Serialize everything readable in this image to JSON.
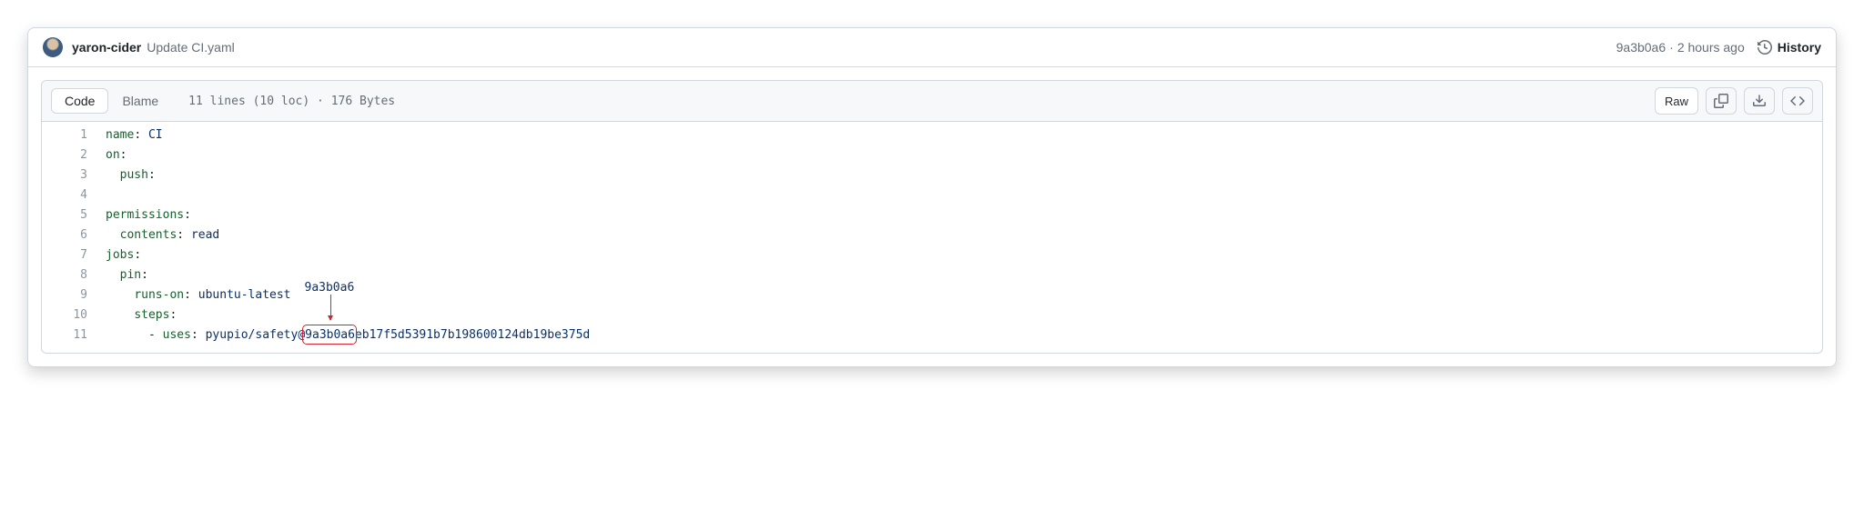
{
  "commit_bar": {
    "author": "yaron-cider",
    "message": "Update CI.yaml",
    "sha": "9a3b0a6",
    "sep": " · ",
    "time": "2 hours ago",
    "history_label": "History"
  },
  "toolbar": {
    "tab_code": "Code",
    "tab_blame": "Blame",
    "meta": "11 lines (10 loc) · 176 Bytes",
    "raw_label": "Raw"
  },
  "code": {
    "lines": [
      [
        [
          "key",
          "name"
        ],
        [
          "pun",
          ": "
        ],
        [
          "str",
          "CI"
        ]
      ],
      [
        [
          "key",
          "on"
        ],
        [
          "pun",
          ":"
        ]
      ],
      [
        [
          "ind",
          "  "
        ],
        [
          "key",
          "push"
        ],
        [
          "pun",
          ":"
        ]
      ],
      [],
      [
        [
          "key",
          "permissions"
        ],
        [
          "pun",
          ":"
        ]
      ],
      [
        [
          "ind",
          "  "
        ],
        [
          "key",
          "contents"
        ],
        [
          "pun",
          ": "
        ],
        [
          "str",
          "read"
        ]
      ],
      [
        [
          "key",
          "jobs"
        ],
        [
          "pun",
          ":"
        ]
      ],
      [
        [
          "ind",
          "  "
        ],
        [
          "key",
          "pin"
        ],
        [
          "pun",
          ":"
        ]
      ],
      [
        [
          "ind",
          "    "
        ],
        [
          "key",
          "runs-on"
        ],
        [
          "pun",
          ": "
        ],
        [
          "str",
          "ubuntu-latest"
        ]
      ],
      [
        [
          "ind",
          "    "
        ],
        [
          "key",
          "steps"
        ],
        [
          "pun",
          ":"
        ]
      ],
      [
        [
          "ind",
          "      "
        ],
        [
          "pun",
          "- "
        ],
        [
          "key",
          "uses"
        ],
        [
          "pun",
          ": "
        ],
        [
          "str",
          "pyupio/safety@9a3b0a6eb17f5d5391b7b198600124db19be375d"
        ]
      ]
    ]
  },
  "annotation": {
    "label": "9a3b0a6"
  }
}
